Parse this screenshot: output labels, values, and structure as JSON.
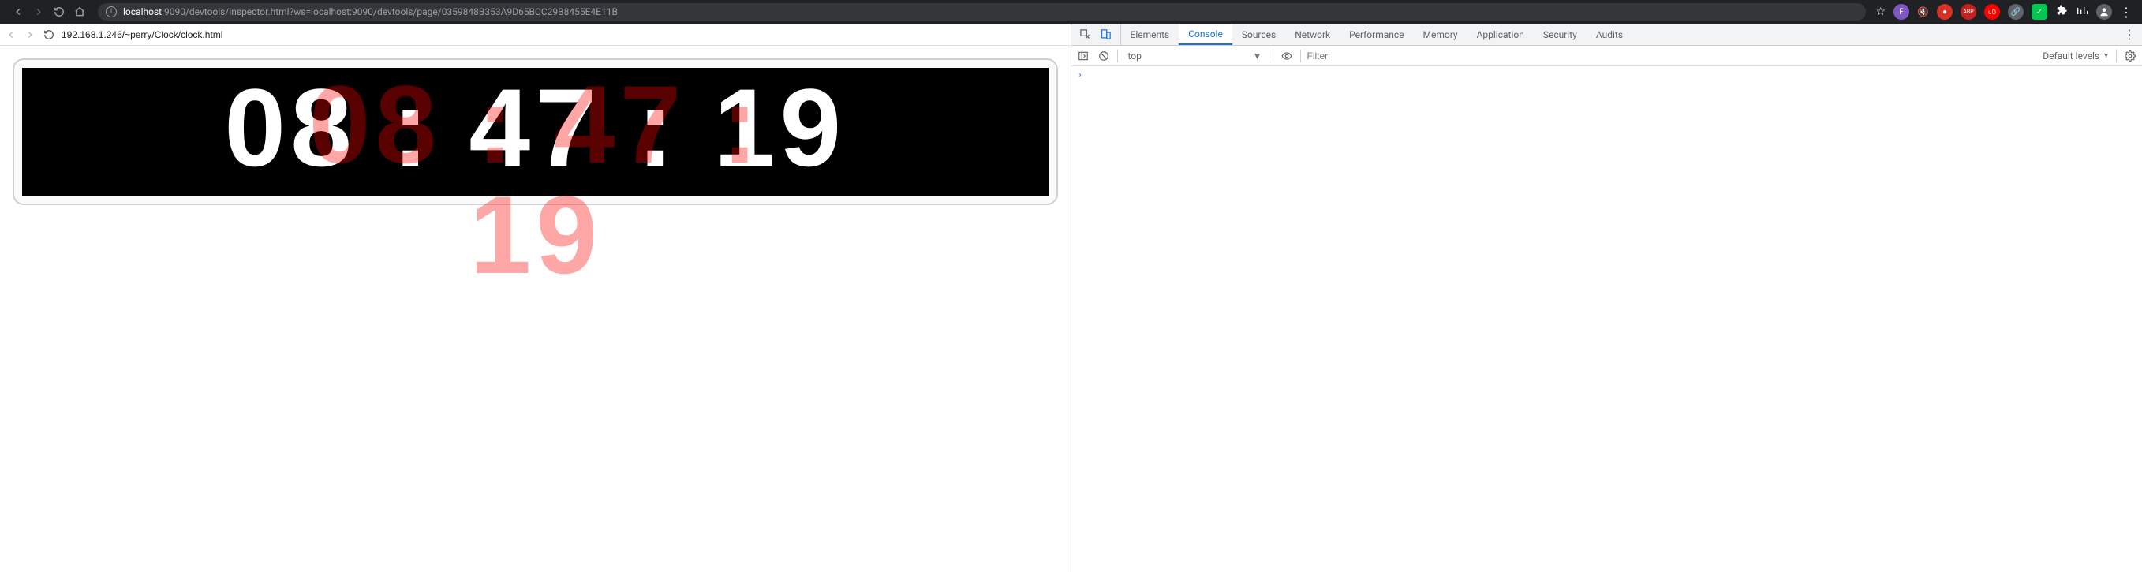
{
  "browser": {
    "omnibox_host": "localhost",
    "omnibox_port": ":9090",
    "omnibox_path": "/devtools/inspector.html?ws=localhost:9090/devtools/page/0359848B353A9D65BCC29B8455E4E11B"
  },
  "page": {
    "url": "192.168.1.246/~perry/Clock/clock.html"
  },
  "clock": {
    "time_display": "08 : 47 : 19"
  },
  "devtools": {
    "tabs": [
      "Elements",
      "Console",
      "Sources",
      "Network",
      "Performance",
      "Memory",
      "Application",
      "Security",
      "Audits"
    ],
    "active_tab": "Console",
    "console": {
      "context": "top",
      "filter_placeholder": "Filter",
      "levels_label": "Default levels",
      "prompt": "›"
    }
  }
}
